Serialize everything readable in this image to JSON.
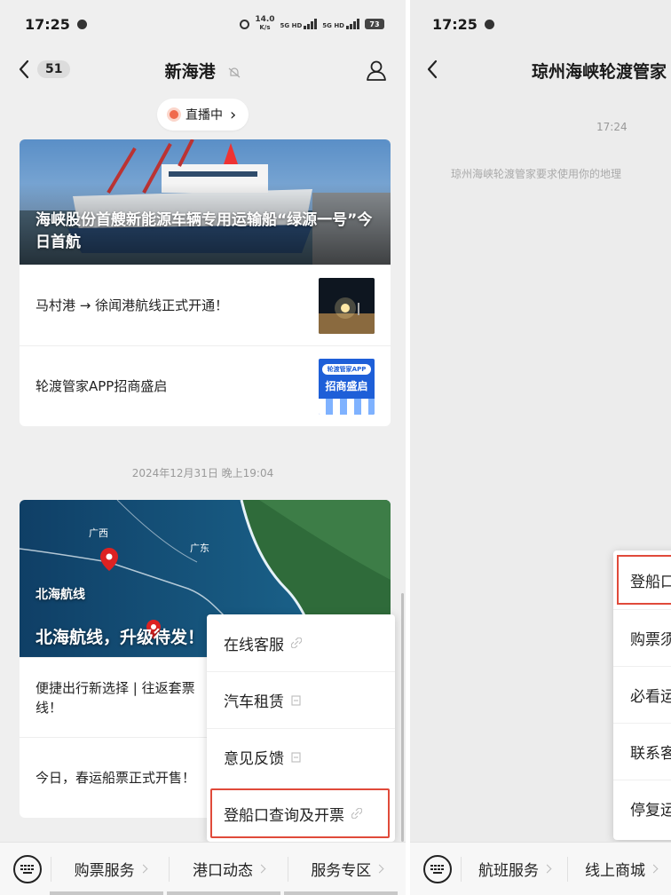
{
  "left": {
    "status": {
      "time": "17:25",
      "net_speed": "14.0",
      "net_unit": "K/s",
      "sig1": "5G HD",
      "sig2": "5G HD",
      "battery": "73"
    },
    "nav": {
      "back_count": "51",
      "title": "新海港"
    },
    "live_pill": {
      "label": "直播中",
      "chevron": "›"
    },
    "card1": {
      "hero_title": "海峡股份首艘新能源车辆专用运输船“绿源一号”今日首航",
      "articles": [
        {
          "title": "马村港 → 徐闻港航线正式开通！"
        },
        {
          "title": "轮渡管家APP招商盛启"
        }
      ],
      "thumb2_lines": [
        "轮渡管家APP",
        "招商盛启"
      ]
    },
    "timestamp": "2024年12月31日 晚上19:04",
    "card2": {
      "map_labels": {
        "guangxi": "广西",
        "guangdong": "广东"
      },
      "hero_tag": "北海航线",
      "hero_title": "北海航线，升级待发！",
      "articles": [
        {
          "title": "便捷出行新选择 | 往返套票线！"
        },
        {
          "title": "今日，春运船票正式开售！"
        }
      ]
    },
    "popup": [
      {
        "label": "在线客服"
      },
      {
        "label": "汽车租赁"
      },
      {
        "label": "意见反馈"
      },
      {
        "label": "登船口查询及开票"
      }
    ],
    "bottom_menu": [
      {
        "label": "购票服务"
      },
      {
        "label": "港口动态"
      },
      {
        "label": "服务专区"
      }
    ]
  },
  "right": {
    "status": {
      "time": "17:25"
    },
    "nav": {
      "title": "琼州海峡轮渡管家"
    },
    "time_label": "17:24",
    "system_message": "琼州海峡轮渡管家要求使用你的地理",
    "popup": [
      {
        "label": "登船口"
      },
      {
        "label": "购票须"
      },
      {
        "label": "必看运"
      },
      {
        "label": "联系客"
      },
      {
        "label": "停复运"
      }
    ],
    "bottom_menu": [
      {
        "label": "航班服务"
      },
      {
        "label": "线上商城"
      }
    ]
  },
  "colors": {
    "accent_red": "#e04a3a",
    "live_dot": "#f06a4c",
    "background": "#efefef"
  },
  "icons": [
    "back-chevron-icon",
    "mute-bell-icon",
    "user-profile-icon",
    "live-dot-icon",
    "keyboard-icon",
    "link-icon",
    "mini-program-icon",
    "map-pin-icon"
  ]
}
